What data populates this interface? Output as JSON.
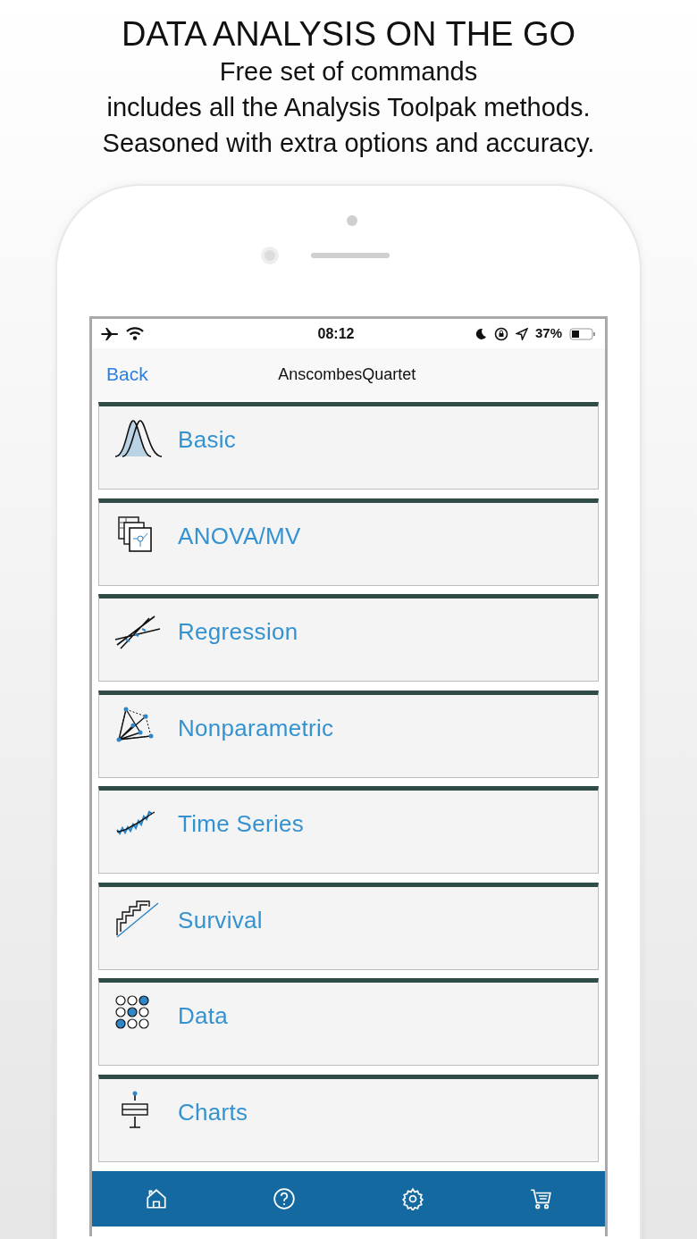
{
  "promo": {
    "headline": "DATA ANALYSIS ON THE GO",
    "lines": [
      "Free set of commands",
      "includes all the Analysis Toolpak methods.",
      "Seasoned with extra options and accuracy."
    ]
  },
  "status_bar": {
    "time": "08:12",
    "battery": "37%"
  },
  "nav_bar": {
    "back": "Back",
    "title": "AnscombesQuartet"
  },
  "categories": [
    {
      "label": "Basic",
      "kind": "basic"
    },
    {
      "label": "ANOVA/MV",
      "kind": "anova"
    },
    {
      "label": "Regression",
      "kind": "regression"
    },
    {
      "label": "Nonparametric",
      "kind": "nonparametric"
    },
    {
      "label": "Time Series",
      "kind": "timeseries"
    },
    {
      "label": "Survival",
      "kind": "survival"
    },
    {
      "label": "Data",
      "kind": "data"
    },
    {
      "label": "Charts",
      "kind": "charts"
    }
  ],
  "tab_bar": [
    {
      "kind": "home"
    },
    {
      "kind": "help"
    },
    {
      "kind": "settings"
    },
    {
      "kind": "cart"
    }
  ]
}
